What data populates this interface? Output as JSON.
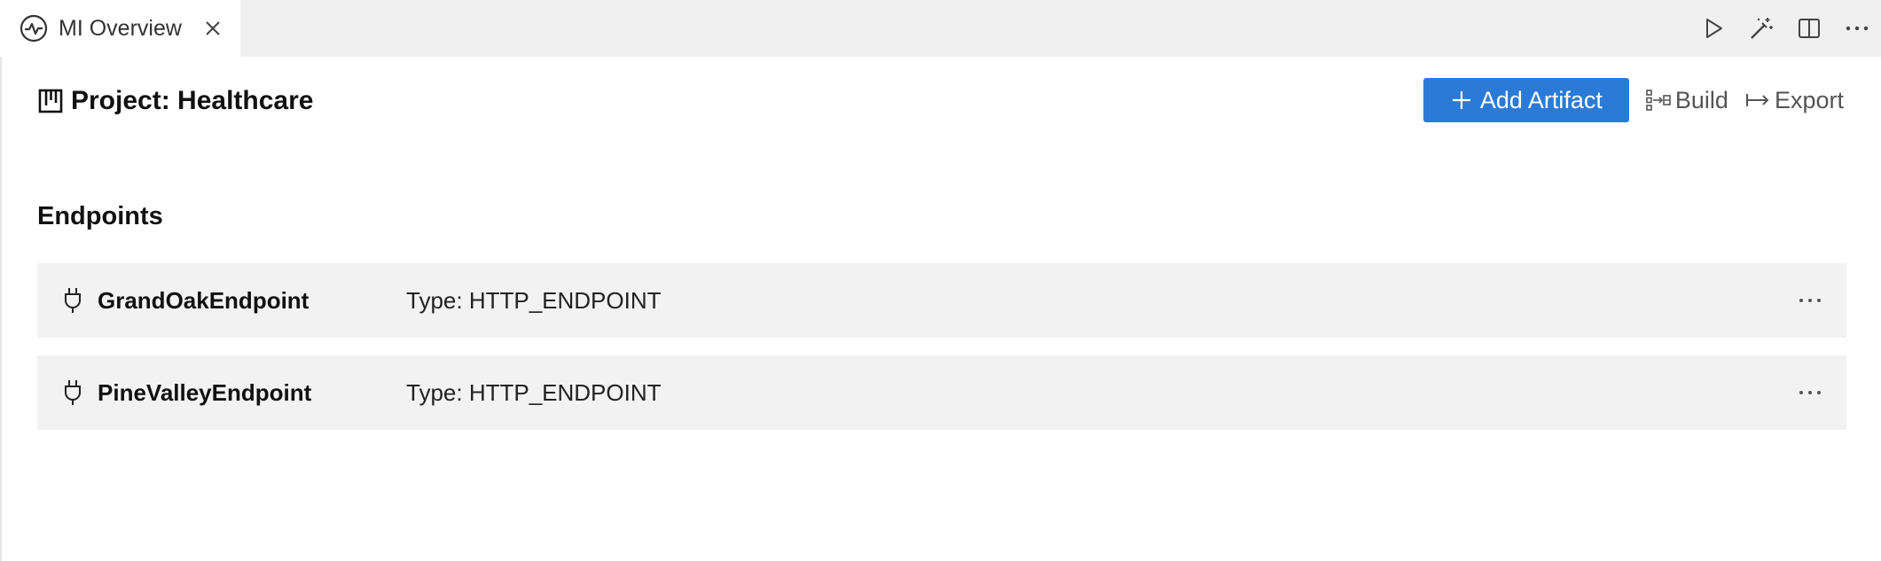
{
  "tab": {
    "label": "MI Overview",
    "icon": "pulse-circle-icon",
    "close_icon": "close-icon"
  },
  "tab_actions": [
    {
      "name": "run",
      "icon": "play-icon"
    },
    {
      "name": "ai-assist",
      "icon": "magic-wand-icon"
    },
    {
      "name": "split-editor",
      "icon": "split-editor-icon"
    },
    {
      "name": "more-actions",
      "icon": "ellipsis-icon"
    }
  ],
  "header": {
    "title": "Project: Healthcare",
    "icon": "project-board-icon",
    "add_artifact_label": "Add Artifact",
    "build_label": "Build",
    "export_label": "Export"
  },
  "endpoints": {
    "title": "Endpoints",
    "items": [
      {
        "name": "GrandOakEndpoint",
        "type": "Type: HTTP_ENDPOINT",
        "icon": "plug-icon"
      },
      {
        "name": "PineValleyEndpoint",
        "type": "Type: HTTP_ENDPOINT",
        "icon": "plug-icon"
      }
    ]
  },
  "colors": {
    "accent": "#2b7bd6",
    "tabbar_bg": "#f0f0f0",
    "row_bg": "#f2f2f2"
  }
}
